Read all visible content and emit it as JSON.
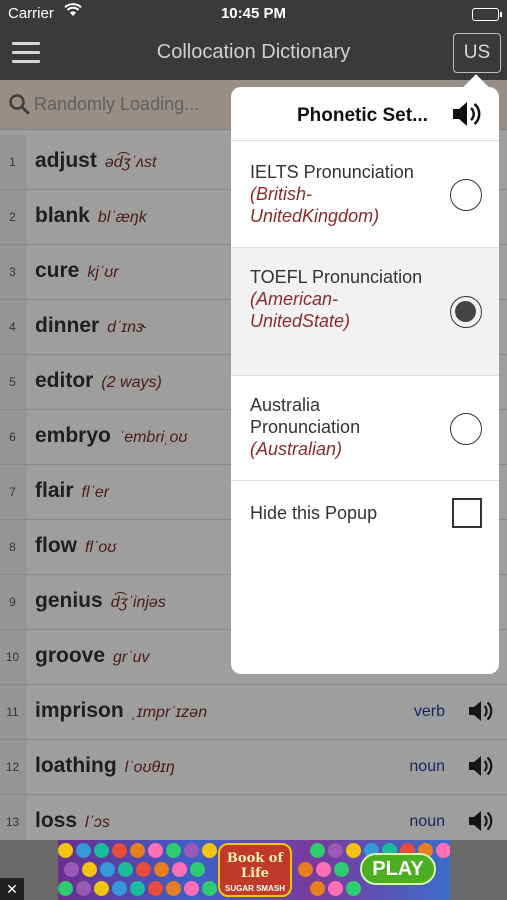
{
  "status_bar": {
    "carrier": "Carrier",
    "time": "10:45 PM"
  },
  "nav": {
    "title": "Collocation Dictionary",
    "language_button": "US"
  },
  "search": {
    "placeholder": "Randomly Loading..."
  },
  "words": [
    {
      "num": "1",
      "word": "adjust",
      "phonetic": "əd͡ʒˈʌst",
      "pos": "",
      "show_speaker": false
    },
    {
      "num": "2",
      "word": "blank",
      "phonetic": "blˈæŋk",
      "pos": "",
      "show_speaker": false
    },
    {
      "num": "3",
      "word": "cure",
      "phonetic": "kjˈʊr",
      "pos": "",
      "show_speaker": false
    },
    {
      "num": "4",
      "word": "dinner",
      "phonetic": "dˈɪnɝ",
      "pos": "",
      "show_speaker": false
    },
    {
      "num": "5",
      "word": "editor",
      "phonetic": "(2 ways)",
      "pos": "",
      "show_speaker": false
    },
    {
      "num": "6",
      "word": "embryo",
      "phonetic": "ˈembriˌoʊ",
      "pos": "",
      "show_speaker": false
    },
    {
      "num": "7",
      "word": "flair",
      "phonetic": "flˈer",
      "pos": "",
      "show_speaker": false
    },
    {
      "num": "8",
      "word": "flow",
      "phonetic": "flˈoʊ",
      "pos": "",
      "show_speaker": false
    },
    {
      "num": "9",
      "word": "genius",
      "phonetic": "d͡ʒˈinjəs",
      "pos": "",
      "show_speaker": false
    },
    {
      "num": "10",
      "word": "groove",
      "phonetic": "grˈuv",
      "pos": "",
      "show_speaker": false
    },
    {
      "num": "11",
      "word": "imprison",
      "phonetic": "ˌɪmprˈɪzən",
      "pos": "verb",
      "show_speaker": true
    },
    {
      "num": "12",
      "word": "loathing",
      "phonetic": "lˈoʊθɪŋ",
      "pos": "noun",
      "show_speaker": true
    },
    {
      "num": "13",
      "word": "loss",
      "phonetic": "lˈɔs",
      "pos": "noun",
      "show_speaker": true
    }
  ],
  "popup": {
    "title": "Phonetic Set...",
    "options": [
      {
        "name": "IELTS Pronunciation",
        "region": "(British-UnitedKingdom)",
        "selected": false
      },
      {
        "name": "TOEFL Pronunciation",
        "region": "(American-UnitedState)",
        "selected": true
      },
      {
        "name": "Australia Pronunciation",
        "region": "(Australian)",
        "selected": false
      }
    ],
    "hide_label": "Hide this Popup",
    "hide_checked": false
  },
  "ad": {
    "close_label": "✕",
    "logo_title": "Book of Life",
    "logo_subtitle": "SUGAR SMASH",
    "play_label": "PLAY"
  },
  "colors": {
    "nav_background": "#3a3a3a",
    "search_background": "#f4e6dc",
    "phonetic_text": "#7a2d2d",
    "pos_text": "#2b3a9a",
    "popup_region_text": "#8a2c2c"
  },
  "icons": {
    "menu": "hamburger-icon",
    "search": "search-icon",
    "speaker": "speaker-icon",
    "wifi": "wifi-icon",
    "battery": "battery-icon"
  }
}
